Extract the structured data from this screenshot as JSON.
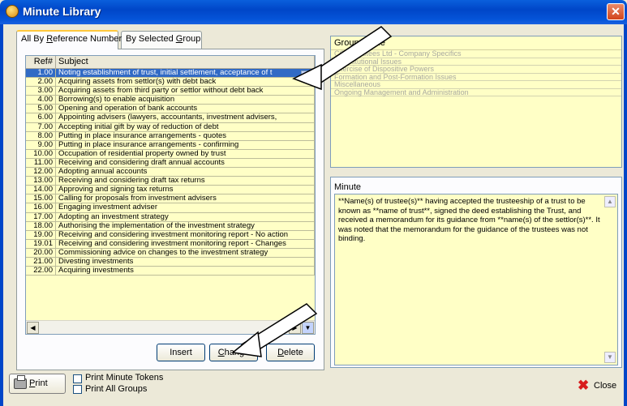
{
  "window": {
    "title": "Minute Library",
    "close_glyph": "✕"
  },
  "tabs": [
    {
      "label_pre": "All By ",
      "label_u": "R",
      "label_post": "eference Number"
    },
    {
      "label_pre": "By Selected ",
      "label_u": "G",
      "label_post": "roup"
    }
  ],
  "grid": {
    "header_ref": "Ref#",
    "header_subject": "Subject",
    "rows": [
      {
        "ref": "1.00",
        "subject": "Noting establishment of trust, initial settlement, acceptance of t"
      },
      {
        "ref": "2.00",
        "subject": "Acquiring assets from settlor(s) with debt back"
      },
      {
        "ref": "3.00",
        "subject": "Acquiring assets from third party or settlor without debt back"
      },
      {
        "ref": "4.00",
        "subject": "Borrowing(s) to enable acquisition"
      },
      {
        "ref": "5.00",
        "subject": "Opening and operation of bank accounts"
      },
      {
        "ref": "6.00",
        "subject": "Appointing advisers (lawyers, accountants, investment advisers,"
      },
      {
        "ref": "7.00",
        "subject": "Accepting initial gift by way of reduction of debt"
      },
      {
        "ref": "8.00",
        "subject": "Putting in place insurance arrangements - quotes"
      },
      {
        "ref": "9.00",
        "subject": "Putting in place insurance arrangements - confirming"
      },
      {
        "ref": "10.00",
        "subject": "Occupation of residential property owned by trust"
      },
      {
        "ref": "11.00",
        "subject": "Receiving and considering draft annual accounts"
      },
      {
        "ref": "12.00",
        "subject": "Adopting annual accounts"
      },
      {
        "ref": "13.00",
        "subject": "Receiving and considering draft tax returns"
      },
      {
        "ref": "14.00",
        "subject": "Approving and signing tax returns"
      },
      {
        "ref": "15.00",
        "subject": "Calling for proposals from investment advisers"
      },
      {
        "ref": "16.00",
        "subject": "Engaging investment adviser"
      },
      {
        "ref": "17.00",
        "subject": "Adopting an investment strategy"
      },
      {
        "ref": "18.00",
        "subject": "Authorising the implementation of the investment strategy"
      },
      {
        "ref": "19.00",
        "subject": "Receiving and considering investment monitoring report - No action"
      },
      {
        "ref": "19.01",
        "subject": "Receiving and considering investment monitoring report - Changes"
      },
      {
        "ref": "20.00",
        "subject": "Commissioning advice on changes to the investment strategy"
      },
      {
        "ref": "21.00",
        "subject": "Divesting investments"
      },
      {
        "ref": "22.00",
        "subject": "Acquiring investments"
      }
    ]
  },
  "buttons": {
    "insert": "Insert",
    "change_u": "C",
    "change_rest": "hange",
    "delete_u": "D",
    "delete_rest": "elete"
  },
  "group_panel": {
    "header": "Group Name",
    "items": [
      "CCH Trustees Ltd - Company Specifics",
      "Constitutional Issues",
      "Exercise of Dispositive Powers",
      "Formation and Post-Formation Issues",
      "Miscellaneous",
      "Ongoing Management and Administration"
    ]
  },
  "minute_panel": {
    "label": "Minute",
    "text": "**Name(s) of trustee(s)** having accepted the trusteeship of a trust to be known as **name of trust**, signed the deed establishing the Trust, and received a memorandum for its guidance from **name(s) of the settlor(s)**. It was noted that the memorandum for the guidance of the trustees was not binding."
  },
  "bottom": {
    "print_u": "P",
    "print_rest": "rint",
    "print_minute_tokens": "Print Minute Tokens",
    "print_all_groups": "Print All Groups",
    "close": "Close"
  },
  "scroll_glyphs": {
    "left": "◀",
    "right": "▶",
    "down": "▼",
    "up": "▲"
  },
  "colors": {
    "list_background": "#ffffc6",
    "selection": "#316ac5",
    "title_bar": "#0046c8"
  }
}
